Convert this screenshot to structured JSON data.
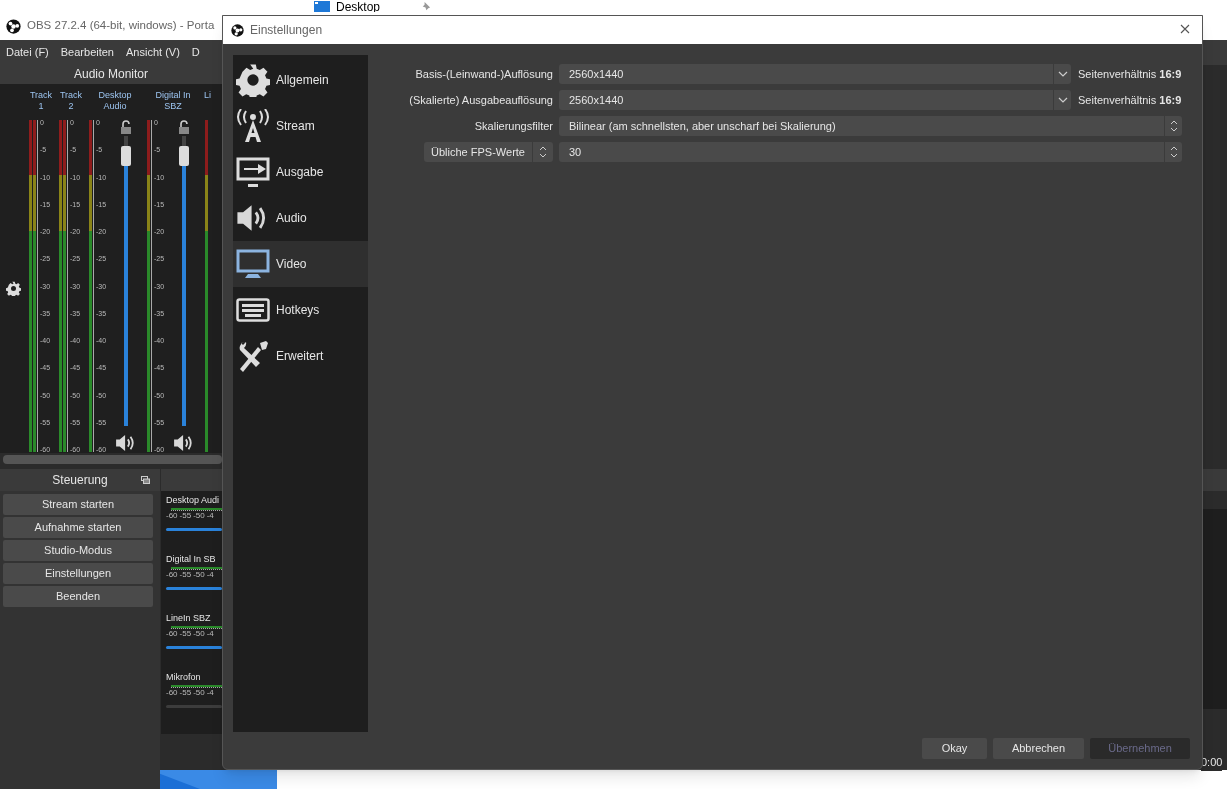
{
  "desktop": {
    "item": "Desktop"
  },
  "main_window": {
    "title": "OBS 27.2.4 (64-bit, windows) - Porta",
    "menu": [
      "Datei (F)",
      "Bearbeiten",
      "Ansicht (V)",
      "D"
    ],
    "audio_monitor": {
      "title": "Audio Monitor",
      "channels": [
        {
          "name": "Track\n1",
          "kind": "track",
          "scale": [
            "0",
            "-5",
            "-10",
            "-15",
            "-20",
            "-25",
            "-30",
            "-35",
            "-40",
            "-45",
            "-50",
            "-55",
            "-60"
          ]
        },
        {
          "name": "Track\n2",
          "kind": "track",
          "scale": [
            "0",
            "-5",
            "-10",
            "-15",
            "-20",
            "-25",
            "-30",
            "-35",
            "-40",
            "-45",
            "-50",
            "-55",
            "-60"
          ]
        },
        {
          "name": "Desktop\nAudio",
          "kind": "source",
          "level": 0.93,
          "scale": [
            "0",
            "-5",
            "-10",
            "-15",
            "-20",
            "-25",
            "-30",
            "-35",
            "-40",
            "-45",
            "-50",
            "-55",
            "-60"
          ]
        },
        {
          "name": "Digital In\nSBZ",
          "kind": "source",
          "level": 0.93,
          "scale": [
            "0",
            "-5",
            "-10",
            "-15",
            "-20",
            "-25",
            "-30",
            "-35",
            "-40",
            "-45",
            "-50",
            "-55",
            "-60"
          ]
        },
        {
          "name": "Li",
          "kind": "cut"
        }
      ]
    },
    "controls": {
      "title": "Steuerung",
      "buttons": [
        "Stream starten",
        "Aufnahme starten",
        "Studio-Modus",
        "Einstellungen",
        "Beenden"
      ]
    },
    "mixer": [
      {
        "name": "Desktop Audi",
        "scale": [
          "-60",
          "-55",
          "-50",
          "-4"
        ],
        "muted": false
      },
      {
        "name": "Digital In SB",
        "scale": [
          "-60",
          "-55",
          "-50",
          "-4"
        ],
        "muted": false
      },
      {
        "name": "LineIn SBZ",
        "scale": [
          "-60",
          "-55",
          "-50",
          "-4"
        ],
        "muted": false
      },
      {
        "name": "Mikrofon",
        "scale": [
          "-60",
          "-55",
          "-50",
          "-4"
        ],
        "muted": true
      }
    ],
    "status_time": "0:00"
  },
  "settings": {
    "title": "Einstellungen",
    "nav": [
      {
        "label": "Allgemein",
        "selected": false
      },
      {
        "label": "Stream",
        "selected": false
      },
      {
        "label": "Ausgabe",
        "selected": false
      },
      {
        "label": "Audio",
        "selected": false
      },
      {
        "label": "Video",
        "selected": true
      },
      {
        "label": "Hotkeys",
        "selected": false
      },
      {
        "label": "Erweitert",
        "selected": false
      }
    ],
    "rows": [
      {
        "kind": "combo",
        "label": "Basis-(Leinwand-)Auflösung",
        "value": "2560x1440",
        "aspect": "Seitenverhältnis **16:9**"
      },
      {
        "kind": "combo",
        "label": "(Skalierte) Ausgabeauflösung",
        "value": "2560x1440",
        "aspect": "Seitenverhältnis **16:9**"
      },
      {
        "kind": "select",
        "label": "Skalierungsfilter",
        "value": "Bilinear (am schnellsten, aber unscharf bei Skalierung)"
      },
      {
        "kind": "fps",
        "label": "Übliche FPS-Werte",
        "value": "30"
      }
    ],
    "buttons": [
      {
        "label": "Okay",
        "disabled": false
      },
      {
        "label": "Abbrechen",
        "disabled": false
      },
      {
        "label": "Übernehmen",
        "disabled": true
      }
    ]
  }
}
